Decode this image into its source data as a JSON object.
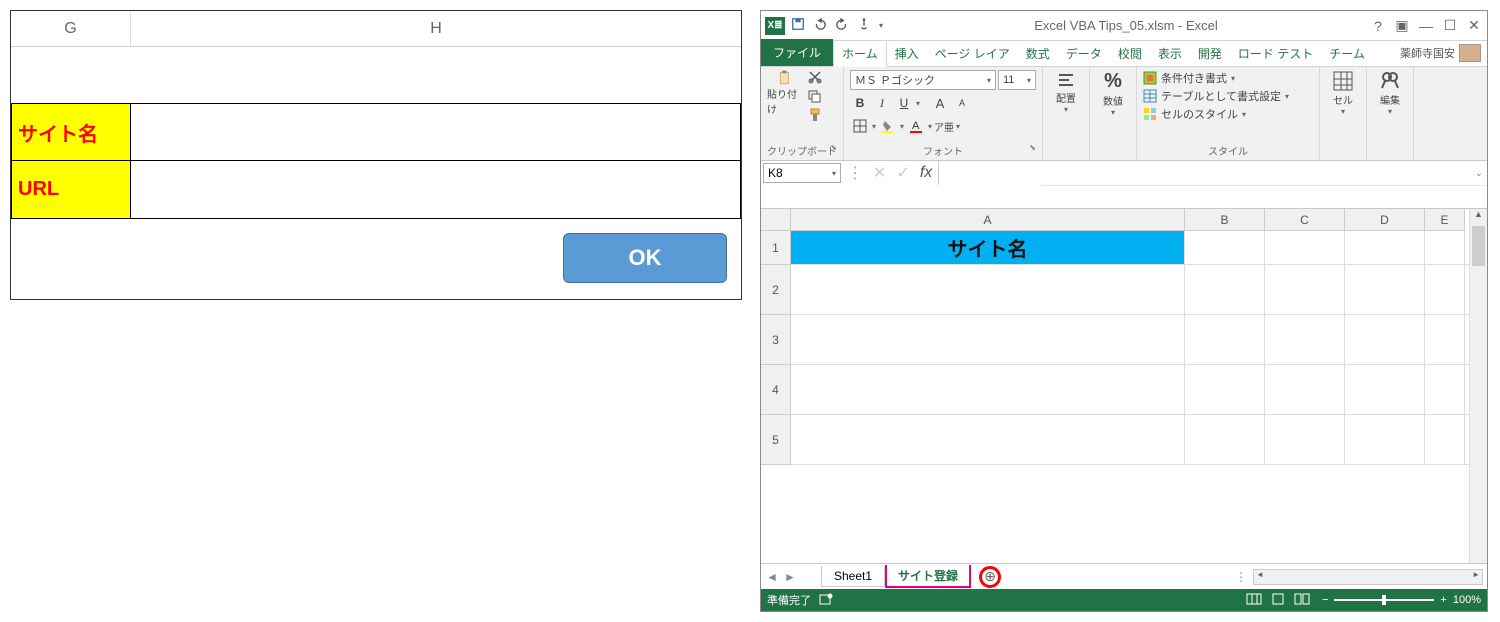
{
  "left": {
    "columns": {
      "g": "G",
      "h": "H"
    },
    "labels": {
      "site_name": "サイト名",
      "url": "URL"
    },
    "ok": "OK"
  },
  "excel": {
    "title": "Excel VBA Tips_05.xlsm - Excel",
    "tabs": {
      "file": "ファイル",
      "home": "ホーム",
      "insert": "挿入",
      "page_layout": "ページ レイア",
      "formulas": "数式",
      "data": "データ",
      "review": "校閲",
      "view": "表示",
      "developer": "開発",
      "load_test": "ロード テスト",
      "team": "チーム"
    },
    "user": "薬師寺国安",
    "ribbon": {
      "clipboard": {
        "label": "クリップボード",
        "paste": "貼り付け"
      },
      "font": {
        "label": "フォント",
        "name": "ＭＳ Ｐゴシック",
        "size": "11"
      },
      "alignment": {
        "label": "配置"
      },
      "number": {
        "label": "数値",
        "icon": "%"
      },
      "styles": {
        "label": "スタイル",
        "cond": "条件付き書式",
        "table": "テーブルとして書式設定",
        "cell": "セルのスタイル"
      },
      "cells": {
        "label": "セル"
      },
      "editing": {
        "label": "編集"
      }
    },
    "name_box": "K8",
    "fx": "fx",
    "columns": [
      "A",
      "B",
      "C",
      "D",
      "E"
    ],
    "rows": [
      "1",
      "2",
      "3",
      "4",
      "5"
    ],
    "a1_value": "サイト名",
    "sheet_tabs": {
      "sheet1": "Sheet1",
      "sheet2": "サイト登録"
    },
    "status": "準備完了",
    "zoom": "100%"
  }
}
